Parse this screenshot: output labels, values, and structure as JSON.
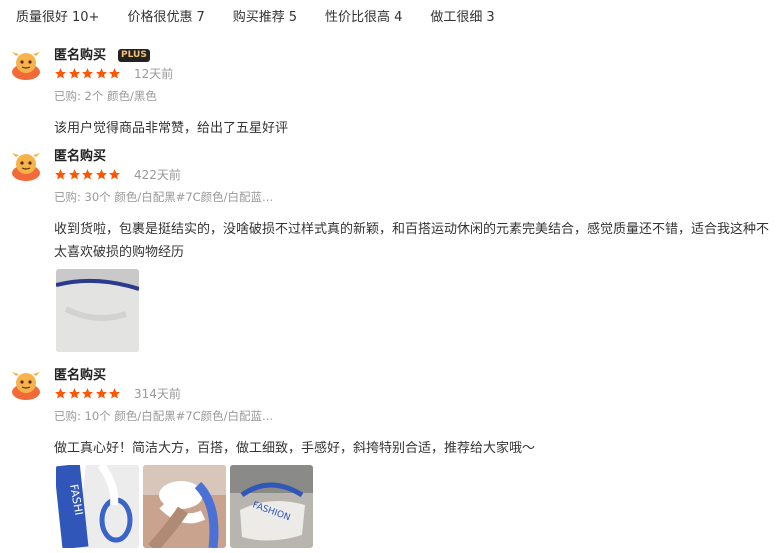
{
  "tags": [
    {
      "label": "质量很好",
      "count": "10+"
    },
    {
      "label": "价格很优惠",
      "count": "7"
    },
    {
      "label": "购买推荐",
      "count": "5"
    },
    {
      "label": "性价比很高",
      "count": "4"
    },
    {
      "label": "做工很细",
      "count": "3"
    }
  ],
  "reviews": [
    {
      "username": "匿名购买",
      "badge": "PLUS",
      "rating": 5,
      "time": "12天前",
      "bought": "已购: 2个 颜色/黑色",
      "content": "该用户觉得商品非常赞，给出了五星好评",
      "photos": []
    },
    {
      "username": "匿名购买",
      "rating": 5,
      "time": "422天前",
      "bought": "已购: 30个 颜色/白配黑#7C颜色/白配蓝...",
      "content": "收到货啦，包裹是挺结实的，没啥破损不过样式真的新颖，和百搭运动休闲的元素完美结合，感觉质量还不错，适合我这种不太喜欢破损的购物经历",
      "photos": [
        "bag-photo"
      ]
    },
    {
      "username": "匿名购买",
      "rating": 5,
      "time": "314天前",
      "bought": "已购: 10个 颜色/白配黑#7C颜色/白配蓝...",
      "content": "做工真心好！简洁大方，百搭，做工细致，手感好，斜挎特别合适，推荐给大家哦～",
      "photos": [
        "strap-photo",
        "knot-photo",
        "bag-photo"
      ]
    }
  ],
  "colors": {
    "star": "#ff5500",
    "muted": "#999999",
    "badge_bg": "#222222",
    "badge_text": "#f2c46b"
  }
}
